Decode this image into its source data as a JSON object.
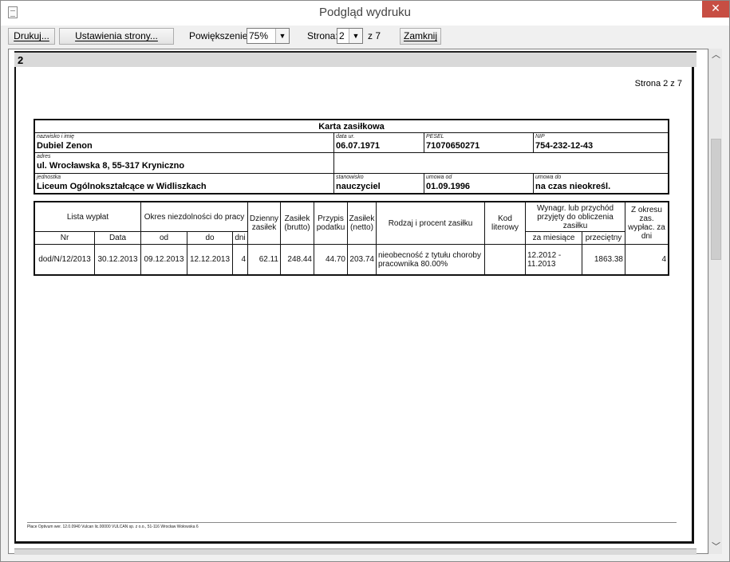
{
  "window": {
    "title": "Podgląd wydruku",
    "close_glyph": "✕"
  },
  "toolbar": {
    "print_label": "Drukuj...",
    "page_setup_label": "Ustawienia strony...",
    "zoom_label": "Powiększenie:",
    "zoom_value": "75%",
    "page_label": "Strona:",
    "page_value": "2",
    "page_of": "z 7",
    "close_label": "Zamknij"
  },
  "page": {
    "number": "2",
    "page_of_text": "Strona 2 z 7",
    "footer": "Płace Optivum wer. 12.0.0940 Vulcan lic.00000 VULCAN sp. z o.o., 51-116 Wrocław Wołowska 6"
  },
  "card": {
    "title": "Karta zasiłkowa",
    "name_label": "nazwisko i imię",
    "name": "Dubiel Zenon",
    "birth_label": "data ur.",
    "birth": "06.07.1971",
    "pesel_label": "PESEL",
    "pesel": "71070650271",
    "nip_label": "NIP",
    "nip": "754-232-12-43",
    "address_label": "adres",
    "address": "ul. Wrocławska 8, 55-317 Kryniczno",
    "unit_label": "jednostka",
    "unit": "Liceum Ogólnokształcące w Widliszkach",
    "position_label": "stanowisko",
    "position": "nauczyciel",
    "contract_from_label": "umowa od",
    "contract_from": "01.09.1996",
    "contract_to_label": "umowa do",
    "contract_to": "na czas nieokreśl."
  },
  "table": {
    "headers": {
      "lista": "Lista wypłat",
      "nr": "Nr",
      "data": "Data",
      "okres": "Okres niezdolności do pracy",
      "od": "od",
      "do": "do",
      "dni": "dni",
      "dzienny": "Dzienny zasiłek",
      "zasilek_brutto": "Zasiłek (brutto)",
      "przypis": "Przypis podatku",
      "zasilek_netto": "Zasiłek (netto)",
      "rodzaj": "Rodzaj i procent zasiłku",
      "kod": "Kod literowy",
      "wynagr": "Wynagr. lub przychód przyjęty do obliczenia zasiłku",
      "za_miesiace": "za miesiące",
      "przecietny": "przeciętny",
      "z_okresu": "Z okresu zas. wypłac. za dni"
    },
    "row": {
      "nr": "dod/N/12/2013",
      "data": "30.12.2013",
      "od": "09.12.2013",
      "do": "12.12.2013",
      "dni": "4",
      "dzienny": "62.11",
      "brutto": "248.44",
      "przypis": "44.70",
      "netto": "203.74",
      "rodzaj": "nieobecność z tytułu choroby pracownika 80.00%",
      "kod": "",
      "za_miesiace": "12.2012 - 11.2013",
      "przecietny": "1863.38",
      "z_okresu": "4"
    }
  }
}
